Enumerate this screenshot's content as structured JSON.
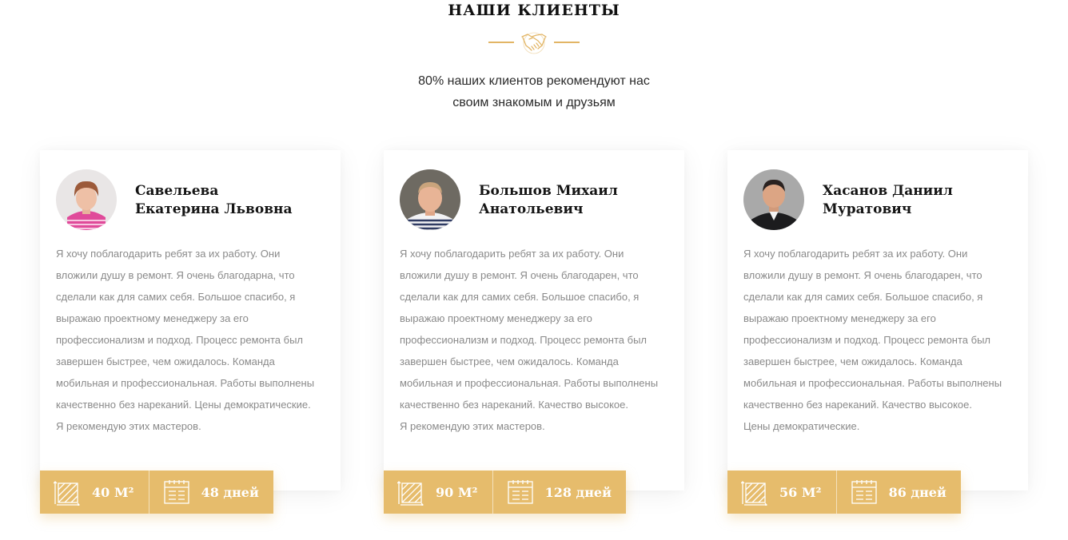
{
  "section": {
    "title": "НАШИ КЛИЕНТЫ",
    "emblem_icon": "handshake-icon",
    "subtitle_line1": "80% наших клиентов рекомендуют нас",
    "subtitle_line2": "своим знакомым и друзьям"
  },
  "colors": {
    "accent": "#e6bc6c",
    "text_muted": "#8a8a8a",
    "heading": "#151515"
  },
  "reviews": [
    {
      "name_line1": "Савельева",
      "name_line2": "Екатерина Львовна",
      "text": [
        "Я хочу поблагодарить ребят за их работу. Они",
        "вложили душу в ремонт. Я очень благодарна, что",
        "сделали как для самих себя. Большое спасибо, я",
        "выражаю проектному менеджеру за его",
        "профессионализм и подход. Процесс ремонта был",
        "завершен быстрее, чем ожидалось. Команда",
        "мобильная и профессиональная. Работы выполнены",
        "качественно без нареканий. Цены демократические.",
        "Я рекомендую этих мастеров."
      ],
      "area": "40 М²",
      "duration": "48 дней"
    },
    {
      "name_line1": "Большов Михаил",
      "name_line2": "Анатольевич",
      "text": [
        "Я хочу поблагодарить ребят за их работу. Они",
        "вложили душу в ремонт. Я очень благодарен, что",
        "сделали как для самих себя. Большое спасибо, я",
        "выражаю проектному менеджеру за его",
        "профессионализм и подход. Процесс ремонта был",
        "завершен быстрее, чем ожидалось. Команда",
        "мобильная и профессиональная. Работы выполнены",
        "качественно без нареканий. Качество высокое.",
        "Я рекомендую этих мастеров."
      ],
      "area": "90 М²",
      "duration": "128 дней"
    },
    {
      "name_line1": "Хасанов Даниил",
      "name_line2": "Муратович",
      "text": [
        "Я хочу поблагодарить ребят за их работу. Они",
        "вложили душу в ремонт. Я очень благодарен, что",
        "сделали как для самих себя. Большое спасибо, я",
        "выражаю проектному менеджеру за его",
        "профессионализм и подход. Процесс ремонта был",
        "завершен быстрее, чем ожидалось. Команда",
        "мобильная и профессиональная. Работы выполнены",
        "качественно без нареканий. Качество высокое.",
        "Цены демократические."
      ],
      "area": "56 М²",
      "duration": "86 дней"
    }
  ]
}
